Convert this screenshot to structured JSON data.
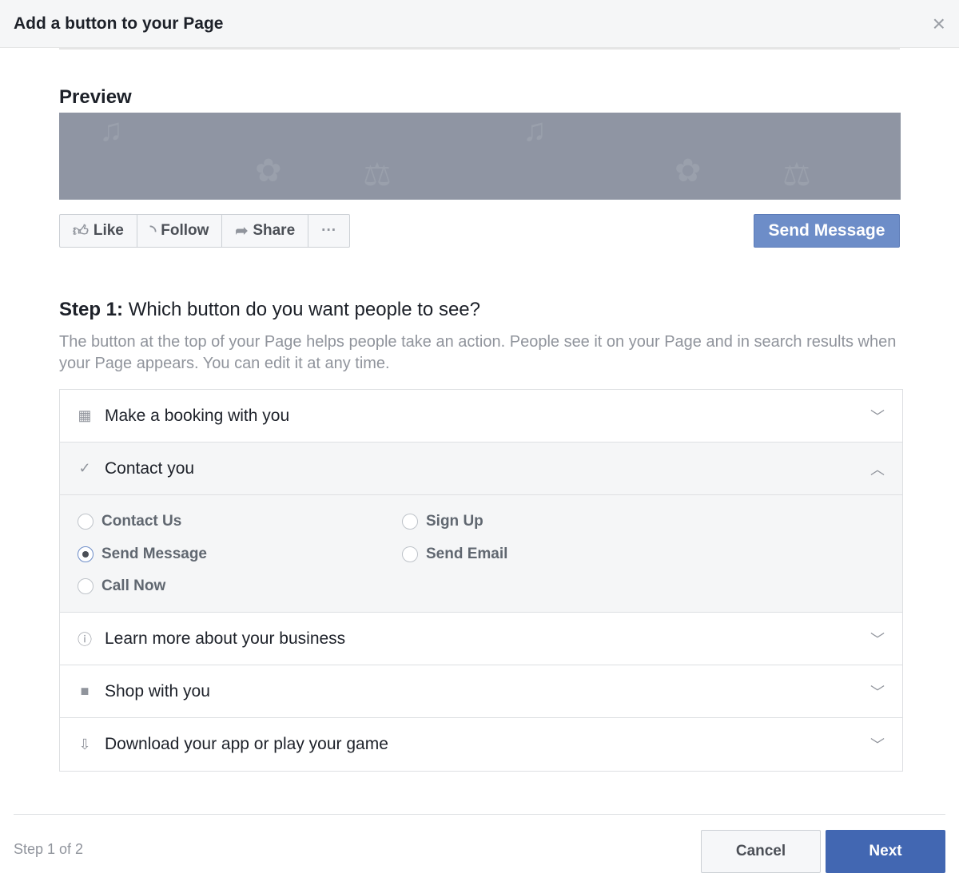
{
  "dialog": {
    "title": "Add a button to your Page",
    "close_icon": "×"
  },
  "preview": {
    "title": "Preview",
    "actions": [
      "Like",
      "Follow",
      "Share",
      "···"
    ],
    "cta": "Send Message"
  },
  "step": {
    "label": "Step 1:",
    "question": "Which button do you want people to see?",
    "description": "The button at the top of your Page helps people take an action. People see it on your Page and in search results when your Page appears. You can edit it at any time."
  },
  "categories": [
    {
      "label": "Make a booking with you",
      "icon": "calendar-icon"
    },
    {
      "label": "Contact you",
      "icon": "check-icon",
      "open": true,
      "options": [
        "Contact Us",
        "Send Message",
        "Call Now",
        "Sign Up",
        "Send Email"
      ],
      "selected": "Send Message"
    },
    {
      "label": "Learn more about your business",
      "icon": "info-icon"
    },
    {
      "label": "Shop with you",
      "icon": "shopping-bag-icon"
    },
    {
      "label": "Download your app or play your game",
      "icon": "download-icon"
    }
  ],
  "footer": {
    "step_of": "Step 1 of 2",
    "cancel": "Cancel",
    "next": "Next"
  }
}
